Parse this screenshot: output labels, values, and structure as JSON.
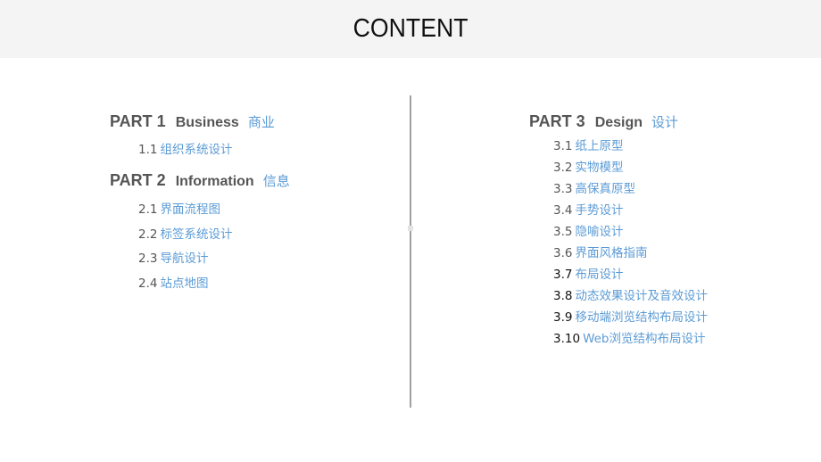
{
  "header": {
    "title": "CONTENT"
  },
  "left": {
    "parts": [
      {
        "num": "PART 1",
        "en": "Business",
        "cn": "商业",
        "items": [
          {
            "num": "1.1",
            "label": "组织系统设计"
          }
        ]
      },
      {
        "num": "PART 2",
        "en": "Information",
        "cn": "信息",
        "items": [
          {
            "num": "2.1",
            "label": "界面流程图"
          },
          {
            "num": "2.2",
            "label": "标签系统设计"
          },
          {
            "num": "2.3",
            "label": "导航设计"
          },
          {
            "num": "2.4",
            "label": "站点地图"
          }
        ]
      }
    ]
  },
  "right": {
    "parts": [
      {
        "num": "PART 3",
        "en": "Design",
        "cn": "设计",
        "items": [
          {
            "num": "3.1",
            "label": "纸上原型"
          },
          {
            "num": "3.2",
            "label": "实物模型"
          },
          {
            "num": "3.3",
            "label": "高保真原型"
          },
          {
            "num": "3.4",
            "label": "手势设计"
          },
          {
            "num": "3.5",
            "label": "隐喻设计"
          },
          {
            "num": "3.6",
            "label": "界面风格指南"
          },
          {
            "num": "3.7",
            "label": "布局设计"
          },
          {
            "num": "3.8",
            "label": "动态效果设计及音效设计"
          },
          {
            "num": "3.9",
            "label": "移动端浏览结构布局设计"
          },
          {
            "num": "3.10",
            "label": "Web浏览结构布局设计"
          }
        ]
      }
    ]
  },
  "colors": {
    "accent": "#5b9bd5",
    "heading": "#555555",
    "header_bg": "#f4f4f4",
    "divider": "#a0a0a0"
  }
}
